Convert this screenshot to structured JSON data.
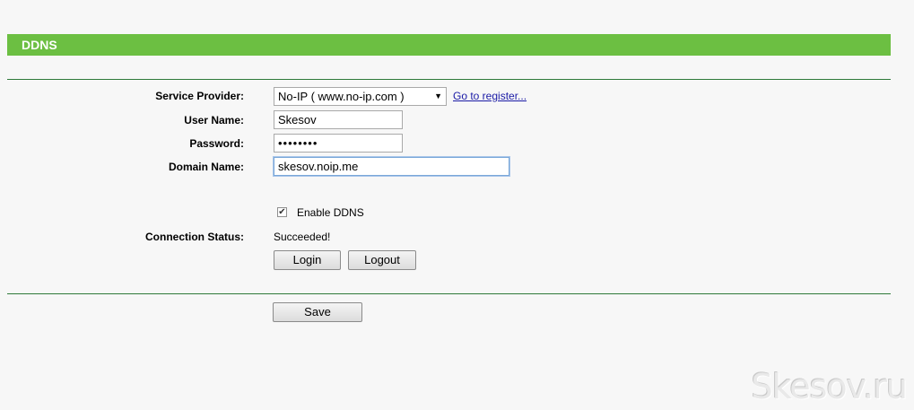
{
  "header": {
    "title": "DDNS"
  },
  "form": {
    "service_provider": {
      "label": "Service Provider:",
      "value": "No-IP ( www.no-ip.com )",
      "register_link": "Go to register..."
    },
    "user_name": {
      "label": "User Name:",
      "value": "Skesov"
    },
    "password": {
      "label": "Password:",
      "value": "••••••••"
    },
    "domain_name": {
      "label": "Domain Name:",
      "value": "skesov.noip.me"
    },
    "enable_ddns": {
      "label": "Enable DDNS",
      "checked": true,
      "check_glyph": "✔"
    },
    "connection_status": {
      "label": "Connection Status:",
      "value": "Succeeded!"
    },
    "buttons": {
      "login": "Login",
      "logout": "Logout",
      "save": "Save"
    }
  },
  "icons": {
    "dropdown": "▼"
  },
  "colors": {
    "header_bar": "#6cbf42",
    "divider": "#2f7a3a",
    "link": "#1a1aa6"
  },
  "watermark": "Skesov.ru"
}
